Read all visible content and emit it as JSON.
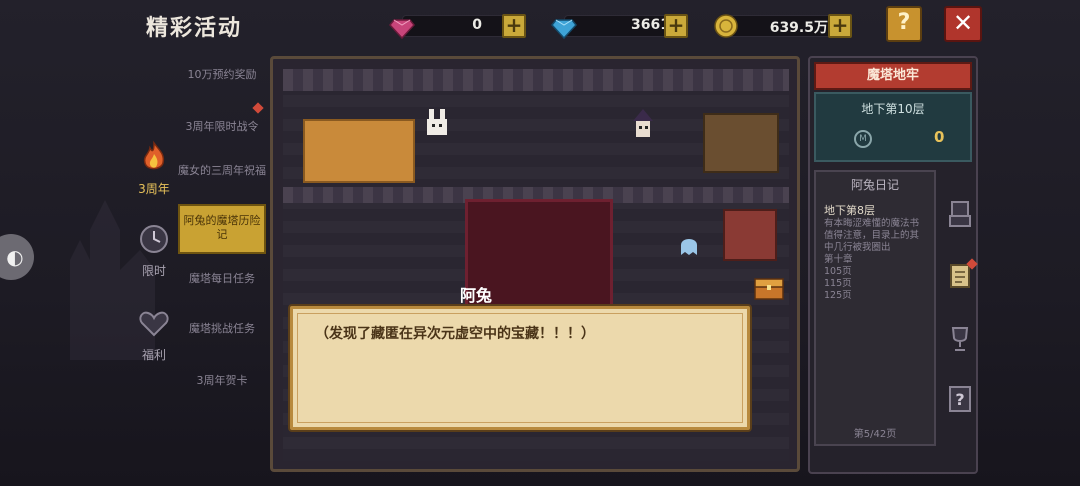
{
  "header": {
    "title": "精彩活动",
    "resources": [
      {
        "name": "gem-purple",
        "value": "0",
        "color": "#c8457a"
      },
      {
        "name": "diamond-blue",
        "value": "3661",
        "color": "#3ea3d6"
      },
      {
        "name": "gold-coin",
        "value": "639.5万",
        "color": "#d8b43c"
      }
    ],
    "help_label": "?",
    "close_label": "✕"
  },
  "categories": [
    {
      "label": "3周年",
      "icon": "flame-icon"
    },
    {
      "label": "限时",
      "icon": "clock-icon"
    },
    {
      "label": "福利",
      "icon": "heart-gift-icon"
    }
  ],
  "menu": [
    {
      "label": "10万预约奖励"
    },
    {
      "label": "3周年限时战令"
    },
    {
      "label": "魔女的三周年祝福"
    },
    {
      "label": "阿兔的魔塔历险记"
    },
    {
      "label": "魔塔每日任务"
    },
    {
      "label": "魔塔挑战任务"
    },
    {
      "label": "3周年贺卡"
    }
  ],
  "side_tab_icon": "◐",
  "dialog": {
    "speaker": "阿兔",
    "text": "（发现了藏匿在异次元虚空中的宝藏！！！）"
  },
  "right_panel": {
    "title": "魔塔地牢",
    "floor": "地下第10层",
    "coin_icon": "M",
    "coin_value": "0",
    "diary": {
      "title": "阿兔日记",
      "subtitle": "地下第8层",
      "body": "有本晦涩难懂的魔法书值得注意，目录上的其中几行被我圈出\n第十章\n105页\n115页\n125页",
      "page": "第5/42页"
    }
  },
  "colors": {
    "accent_gold": "#c9a233",
    "close_red": "#b0352c",
    "panel_title_red": "#b33c30"
  }
}
